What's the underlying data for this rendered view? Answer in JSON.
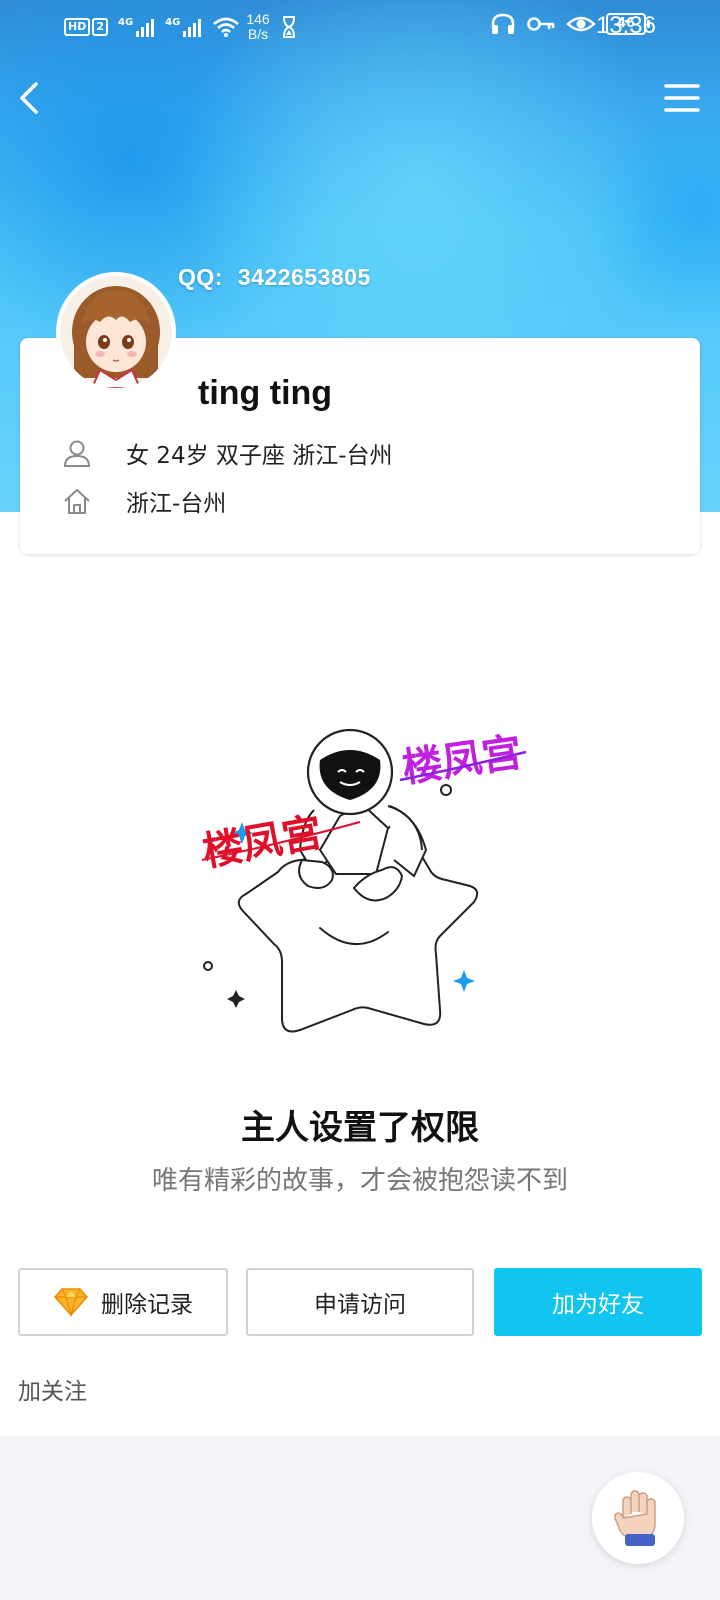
{
  "status_bar": {
    "hd_label": "HD",
    "sim2_label": "2",
    "net1": "4G",
    "net2": "4G",
    "speed_value": "146",
    "speed_unit": "B/s",
    "battery": "46",
    "time": "13:36"
  },
  "profile": {
    "qq_label": "QQ:",
    "qq_number": "3422653805",
    "nickname": "ting ting",
    "basic_info": "女 24岁 双子座 浙江-台州",
    "hometown": "浙江-台州"
  },
  "privacy": {
    "title": "主人设置了权限",
    "subtitle": "唯有精彩的故事，才会被抱怨读不到",
    "watermark": "楼凤宫"
  },
  "actions": {
    "delete_record": "删除记录",
    "request_access": "申请访问",
    "add_friend": "加为好友",
    "follow": "加关注"
  },
  "colors": {
    "primary": "#12c4f0",
    "header_blue": "#3aa8ee",
    "watermark_red": "#e0102a",
    "watermark_magenta": "#c020e0",
    "sparkle_blue": "#1a9cf0"
  }
}
